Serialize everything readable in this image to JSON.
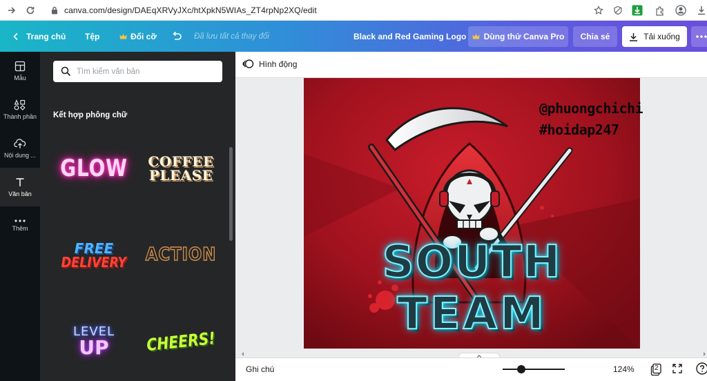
{
  "browser": {
    "url": "canva.com/design/DAEqXRVyJXc/htXpkN5WIAs_ZT4rpNp2XQ/edit"
  },
  "header": {
    "home": "Trang chủ",
    "file": "Tệp",
    "resize": "Đổi cỡ",
    "saved": "Đã lưu tất cả thay đổi",
    "title": "Black and Red Gaming Logo",
    "pro": "Dùng thử Canva Pro",
    "share": "Chia sẻ",
    "download": "Tải xuống"
  },
  "rail": {
    "items": [
      {
        "label": "Mẫu",
        "icon": "template-icon"
      },
      {
        "label": "Thành phần",
        "icon": "elements-icon"
      },
      {
        "label": "Nội dung ...",
        "icon": "upload-icon"
      },
      {
        "label": "Văn bản",
        "icon": "text-icon"
      },
      {
        "label": "Thêm",
        "icon": "more-icon"
      }
    ]
  },
  "panel": {
    "search_placeholder": "Tìm kiếm văn bản",
    "section_title": "Kết hợp phông chữ",
    "fonts": {
      "glow": "GLOW",
      "coffee_1": "COFFEE",
      "coffee_2": "PLEASE",
      "free_1": "FREE",
      "free_2": "DELIVERY",
      "action": "ACTION",
      "level_1": "LEVEL",
      "level_2": "UP",
      "cheers": "CHEERS!"
    }
  },
  "toolbar": {
    "animate": "Hình động"
  },
  "design": {
    "headline_1": "SOUTH",
    "headline_2": "TEAM",
    "watermark_1": "@phuongchichi",
    "watermark_2": "#hoidap247"
  },
  "bottom": {
    "notes": "Ghi chú",
    "zoom": "124%",
    "zoom_level": 0.3,
    "page_count": "2"
  }
}
